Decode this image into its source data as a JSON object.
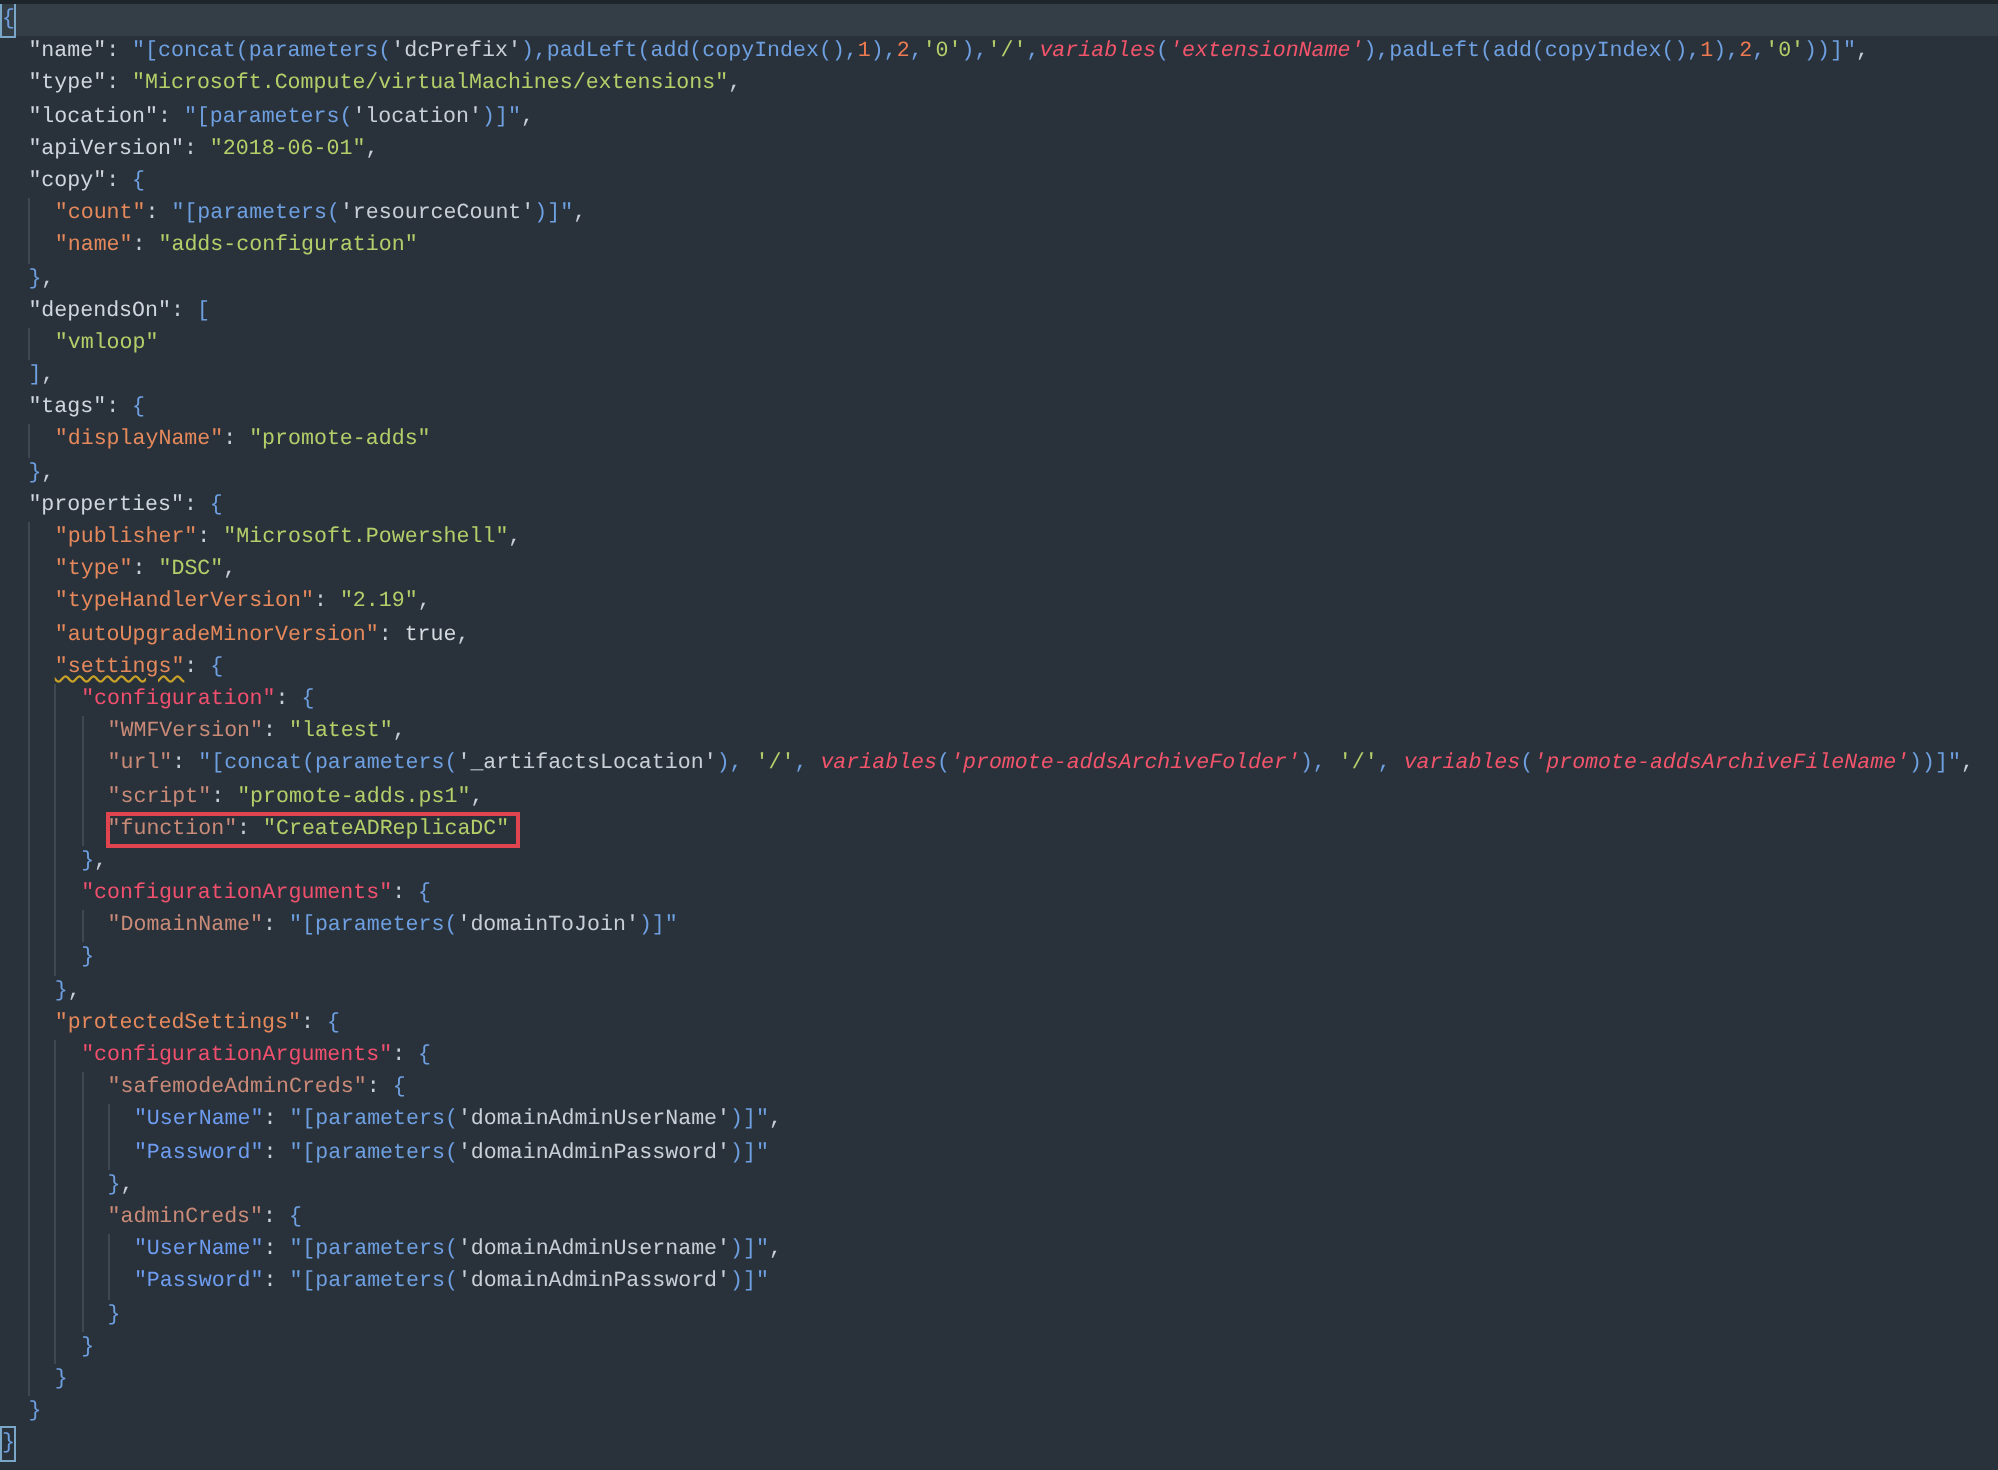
{
  "editor": {
    "lines": [
      {
        "current": true,
        "bracket_matched": true,
        "tokens": [
          {
            "kind": "brace",
            "text": "{"
          }
        ],
        "children": [
          {
            "tokens": [
              {
                "kind": "key",
                "text": "\"name\""
              },
              {
                "kind": "punct",
                "text": ": "
              },
              {
                "kind": "expr",
                "text": "\"[concat(parameters("
              },
              {
                "kind": "arg",
                "text": "'dcPrefix'"
              },
              {
                "kind": "expr",
                "text": "),padLeft(add(copyIndex(),"
              },
              {
                "kind": "num",
                "text": "1"
              },
              {
                "kind": "expr",
                "text": "),"
              },
              {
                "kind": "num",
                "text": "2"
              },
              {
                "kind": "expr",
                "text": ","
              },
              {
                "kind": "str",
                "text": "'0'"
              },
              {
                "kind": "expr",
                "text": "),"
              },
              {
                "kind": "str",
                "text": "'/'"
              },
              {
                "kind": "expr",
                "text": ","
              },
              {
                "kind": "var",
                "text": "variables"
              },
              {
                "kind": "expr",
                "text": "("
              },
              {
                "kind": "var",
                "text": "'extensionName'"
              },
              {
                "kind": "expr",
                "text": "),padLeft(add(copyIndex(),"
              },
              {
                "kind": "num",
                "text": "1"
              },
              {
                "kind": "expr",
                "text": "),"
              },
              {
                "kind": "num",
                "text": "2"
              },
              {
                "kind": "expr",
                "text": ","
              },
              {
                "kind": "str",
                "text": "'0'"
              },
              {
                "kind": "expr",
                "text": "))]\""
              },
              {
                "kind": "punct",
                "text": ","
              }
            ]
          },
          {
            "tokens": [
              {
                "kind": "key",
                "text": "\"type\""
              },
              {
                "kind": "punct",
                "text": ": "
              },
              {
                "kind": "str",
                "text": "\"Microsoft.Compute/virtualMachines/extensions\""
              },
              {
                "kind": "punct",
                "text": ","
              }
            ]
          },
          {
            "tokens": [
              {
                "kind": "key",
                "text": "\"location\""
              },
              {
                "kind": "punct",
                "text": ": "
              },
              {
                "kind": "expr",
                "text": "\"[parameters("
              },
              {
                "kind": "arg",
                "text": "'location'"
              },
              {
                "kind": "expr",
                "text": ")]\""
              },
              {
                "kind": "punct",
                "text": ","
              }
            ]
          },
          {
            "tokens": [
              {
                "kind": "key",
                "text": "\"apiVersion\""
              },
              {
                "kind": "punct",
                "text": ": "
              },
              {
                "kind": "str",
                "text": "\"2018-06-01\""
              },
              {
                "kind": "punct",
                "text": ","
              }
            ]
          },
          {
            "tokens": [
              {
                "kind": "key",
                "text": "\"copy\""
              },
              {
                "kind": "punct",
                "text": ": "
              },
              {
                "kind": "brace",
                "text": "{"
              }
            ],
            "children": [
              {
                "tokens": [
                  {
                    "kind": "key",
                    "text": "\"count\""
                  },
                  {
                    "kind": "punct",
                    "text": ": "
                  },
                  {
                    "kind": "expr",
                    "text": "\"[parameters("
                  },
                  {
                    "kind": "arg",
                    "text": "'resourceCount'"
                  },
                  {
                    "kind": "expr",
                    "text": ")]\""
                  },
                  {
                    "kind": "punct",
                    "text": ","
                  }
                ]
              },
              {
                "tokens": [
                  {
                    "kind": "key",
                    "text": "\"name\""
                  },
                  {
                    "kind": "punct",
                    "text": ": "
                  },
                  {
                    "kind": "str",
                    "text": "\"adds-configuration\""
                  }
                ]
              }
            ]
          },
          {
            "tokens": [
              {
                "kind": "brace",
                "text": "}"
              },
              {
                "kind": "punct",
                "text": ","
              }
            ]
          },
          {
            "tokens": [
              {
                "kind": "key",
                "text": "\"dependsOn\""
              },
              {
                "kind": "punct",
                "text": ": "
              },
              {
                "kind": "brace",
                "text": "["
              }
            ],
            "children": [
              {
                "tokens": [
                  {
                    "kind": "str",
                    "text": "\"vmloop\""
                  }
                ]
              }
            ]
          },
          {
            "tokens": [
              {
                "kind": "brace",
                "text": "]"
              },
              {
                "kind": "punct",
                "text": ","
              }
            ]
          },
          {
            "tokens": [
              {
                "kind": "key",
                "text": "\"tags\""
              },
              {
                "kind": "punct",
                "text": ": "
              },
              {
                "kind": "brace",
                "text": "{"
              }
            ],
            "children": [
              {
                "tokens": [
                  {
                    "kind": "key",
                    "text": "\"displayName\""
                  },
                  {
                    "kind": "punct",
                    "text": ": "
                  },
                  {
                    "kind": "str",
                    "text": "\"promote-adds\""
                  }
                ]
              }
            ]
          },
          {
            "tokens": [
              {
                "kind": "brace",
                "text": "}"
              },
              {
                "kind": "punct",
                "text": ","
              }
            ]
          },
          {
            "tokens": [
              {
                "kind": "key",
                "text": "\"properties\""
              },
              {
                "kind": "punct",
                "text": ": "
              },
              {
                "kind": "brace",
                "text": "{"
              }
            ],
            "children": [
              {
                "tokens": [
                  {
                    "kind": "key",
                    "text": "\"publisher\""
                  },
                  {
                    "kind": "punct",
                    "text": ": "
                  },
                  {
                    "kind": "str",
                    "text": "\"Microsoft.Powershell\""
                  },
                  {
                    "kind": "punct",
                    "text": ","
                  }
                ]
              },
              {
                "tokens": [
                  {
                    "kind": "key",
                    "text": "\"type\""
                  },
                  {
                    "kind": "punct",
                    "text": ": "
                  },
                  {
                    "kind": "str",
                    "text": "\"DSC\""
                  },
                  {
                    "kind": "punct",
                    "text": ","
                  }
                ]
              },
              {
                "tokens": [
                  {
                    "kind": "key",
                    "text": "\"typeHandlerVersion\""
                  },
                  {
                    "kind": "punct",
                    "text": ": "
                  },
                  {
                    "kind": "str",
                    "text": "\"2.19\""
                  },
                  {
                    "kind": "punct",
                    "text": ","
                  }
                ]
              },
              {
                "tokens": [
                  {
                    "kind": "key",
                    "text": "\"autoUpgradeMinorVersion\""
                  },
                  {
                    "kind": "punct",
                    "text": ": "
                  },
                  {
                    "kind": "bool",
                    "text": "true"
                  },
                  {
                    "kind": "punct",
                    "text": ","
                  }
                ]
              },
              {
                "tokens": [
                  {
                    "kind": "key",
                    "text": "\"settings\"",
                    "squiggle": true
                  },
                  {
                    "kind": "punct",
                    "text": ": "
                  },
                  {
                    "kind": "brace",
                    "text": "{"
                  }
                ],
                "children": [
                  {
                    "tokens": [
                      {
                        "kind": "key",
                        "text": "\"configuration\""
                      },
                      {
                        "kind": "punct",
                        "text": ": "
                      },
                      {
                        "kind": "brace",
                        "text": "{"
                      }
                    ],
                    "children": [
                      {
                        "tokens": [
                          {
                            "kind": "key",
                            "text": "\"WMFVersion\""
                          },
                          {
                            "kind": "punct",
                            "text": ": "
                          },
                          {
                            "kind": "str",
                            "text": "\"latest\""
                          },
                          {
                            "kind": "punct",
                            "text": ","
                          }
                        ]
                      },
                      {
                        "tokens": [
                          {
                            "kind": "key",
                            "text": "\"url\""
                          },
                          {
                            "kind": "punct",
                            "text": ": "
                          },
                          {
                            "kind": "expr",
                            "text": "\"[concat(parameters("
                          },
                          {
                            "kind": "arg",
                            "text": "'_artifactsLocation'"
                          },
                          {
                            "kind": "expr",
                            "text": "), "
                          },
                          {
                            "kind": "str",
                            "text": "'/'"
                          },
                          {
                            "kind": "expr",
                            "text": ", "
                          },
                          {
                            "kind": "var",
                            "text": "variables"
                          },
                          {
                            "kind": "expr",
                            "text": "("
                          },
                          {
                            "kind": "var",
                            "text": "'promote-addsArchiveFolder'"
                          },
                          {
                            "kind": "expr",
                            "text": "), "
                          },
                          {
                            "kind": "str",
                            "text": "'/'"
                          },
                          {
                            "kind": "expr",
                            "text": ", "
                          },
                          {
                            "kind": "var",
                            "text": "variables"
                          },
                          {
                            "kind": "expr",
                            "text": "("
                          },
                          {
                            "kind": "var",
                            "text": "'promote-addsArchiveFileName'"
                          },
                          {
                            "kind": "expr",
                            "text": "))]\""
                          },
                          {
                            "kind": "punct",
                            "text": ","
                          }
                        ]
                      },
                      {
                        "tokens": [
                          {
                            "kind": "key",
                            "text": "\"script\""
                          },
                          {
                            "kind": "punct",
                            "text": ": "
                          },
                          {
                            "kind": "str",
                            "text": "\"promote-adds.ps1\""
                          },
                          {
                            "kind": "punct",
                            "text": ","
                          }
                        ]
                      },
                      {
                        "boxed": true,
                        "tokens": [
                          {
                            "kind": "key",
                            "text": "\"function\""
                          },
                          {
                            "kind": "punct",
                            "text": ": "
                          },
                          {
                            "kind": "str",
                            "text": "\"CreateADReplicaDC\""
                          }
                        ]
                      }
                    ]
                  },
                  {
                    "tokens": [
                      {
                        "kind": "brace",
                        "text": "}"
                      },
                      {
                        "kind": "punct",
                        "text": ","
                      }
                    ]
                  },
                  {
                    "tokens": [
                      {
                        "kind": "key",
                        "text": "\"configurationArguments\""
                      },
                      {
                        "kind": "punct",
                        "text": ": "
                      },
                      {
                        "kind": "brace",
                        "text": "{"
                      }
                    ],
                    "children": [
                      {
                        "tokens": [
                          {
                            "kind": "key",
                            "text": "\"DomainName\""
                          },
                          {
                            "kind": "punct",
                            "text": ": "
                          },
                          {
                            "kind": "expr",
                            "text": "\"[parameters("
                          },
                          {
                            "kind": "arg",
                            "text": "'domainToJoin'"
                          },
                          {
                            "kind": "expr",
                            "text": ")]\""
                          }
                        ]
                      }
                    ]
                  },
                  {
                    "tokens": [
                      {
                        "kind": "brace",
                        "text": "}"
                      }
                    ]
                  }
                ]
              },
              {
                "tokens": [
                  {
                    "kind": "brace",
                    "text": "}"
                  },
                  {
                    "kind": "punct",
                    "text": ","
                  }
                ]
              },
              {
                "tokens": [
                  {
                    "kind": "key",
                    "text": "\"protectedSettings\""
                  },
                  {
                    "kind": "punct",
                    "text": ": "
                  },
                  {
                    "kind": "brace",
                    "text": "{"
                  }
                ],
                "children": [
                  {
                    "tokens": [
                      {
                        "kind": "key",
                        "text": "\"configurationArguments\""
                      },
                      {
                        "kind": "punct",
                        "text": ": "
                      },
                      {
                        "kind": "brace",
                        "text": "{"
                      }
                    ],
                    "children": [
                      {
                        "tokens": [
                          {
                            "kind": "key",
                            "text": "\"safemodeAdminCreds\""
                          },
                          {
                            "kind": "punct",
                            "text": ": "
                          },
                          {
                            "kind": "brace",
                            "text": "{"
                          }
                        ],
                        "children": [
                          {
                            "tokens": [
                              {
                                "kind": "key",
                                "text": "\"UserName\""
                              },
                              {
                                "kind": "punct",
                                "text": ": "
                              },
                              {
                                "kind": "expr",
                                "text": "\"[parameters("
                              },
                              {
                                "kind": "arg",
                                "text": "'domainAdminUserName'"
                              },
                              {
                                "kind": "expr",
                                "text": ")]\""
                              },
                              {
                                "kind": "punct",
                                "text": ","
                              }
                            ]
                          },
                          {
                            "tokens": [
                              {
                                "kind": "key",
                                "text": "\"Password\""
                              },
                              {
                                "kind": "punct",
                                "text": ": "
                              },
                              {
                                "kind": "expr",
                                "text": "\"[parameters("
                              },
                              {
                                "kind": "arg",
                                "text": "'domainAdminPassword'"
                              },
                              {
                                "kind": "expr",
                                "text": ")]\""
                              }
                            ]
                          }
                        ]
                      },
                      {
                        "tokens": [
                          {
                            "kind": "brace",
                            "text": "}"
                          },
                          {
                            "kind": "punct",
                            "text": ","
                          }
                        ]
                      },
                      {
                        "tokens": [
                          {
                            "kind": "key",
                            "text": "\"adminCreds\""
                          },
                          {
                            "kind": "punct",
                            "text": ": "
                          },
                          {
                            "kind": "brace",
                            "text": "{"
                          }
                        ],
                        "children": [
                          {
                            "tokens": [
                              {
                                "kind": "key",
                                "text": "\"UserName\""
                              },
                              {
                                "kind": "punct",
                                "text": ": "
                              },
                              {
                                "kind": "expr",
                                "text": "\"[parameters("
                              },
                              {
                                "kind": "arg",
                                "text": "'domainAdminUsername'"
                              },
                              {
                                "kind": "expr",
                                "text": ")]\""
                              },
                              {
                                "kind": "punct",
                                "text": ","
                              }
                            ]
                          },
                          {
                            "tokens": [
                              {
                                "kind": "key",
                                "text": "\"Password\""
                              },
                              {
                                "kind": "punct",
                                "text": ": "
                              },
                              {
                                "kind": "expr",
                                "text": "\"[parameters("
                              },
                              {
                                "kind": "arg",
                                "text": "'domainAdminPassword'"
                              },
                              {
                                "kind": "expr",
                                "text": ")]\""
                              }
                            ]
                          }
                        ]
                      },
                      {
                        "tokens": [
                          {
                            "kind": "brace",
                            "text": "}"
                          }
                        ]
                      }
                    ]
                  },
                  {
                    "tokens": [
                      {
                        "kind": "brace",
                        "text": "}"
                      }
                    ]
                  }
                ]
              },
              {
                "tokens": [
                  {
                    "kind": "brace",
                    "text": "}"
                  }
                ]
              }
            ]
          },
          {
            "tokens": [
              {
                "kind": "brace",
                "text": "}"
              }
            ]
          }
        ]
      },
      {
        "bracket_matched": true,
        "tokens": [
          {
            "kind": "brace",
            "text": "}"
          }
        ]
      }
    ]
  }
}
